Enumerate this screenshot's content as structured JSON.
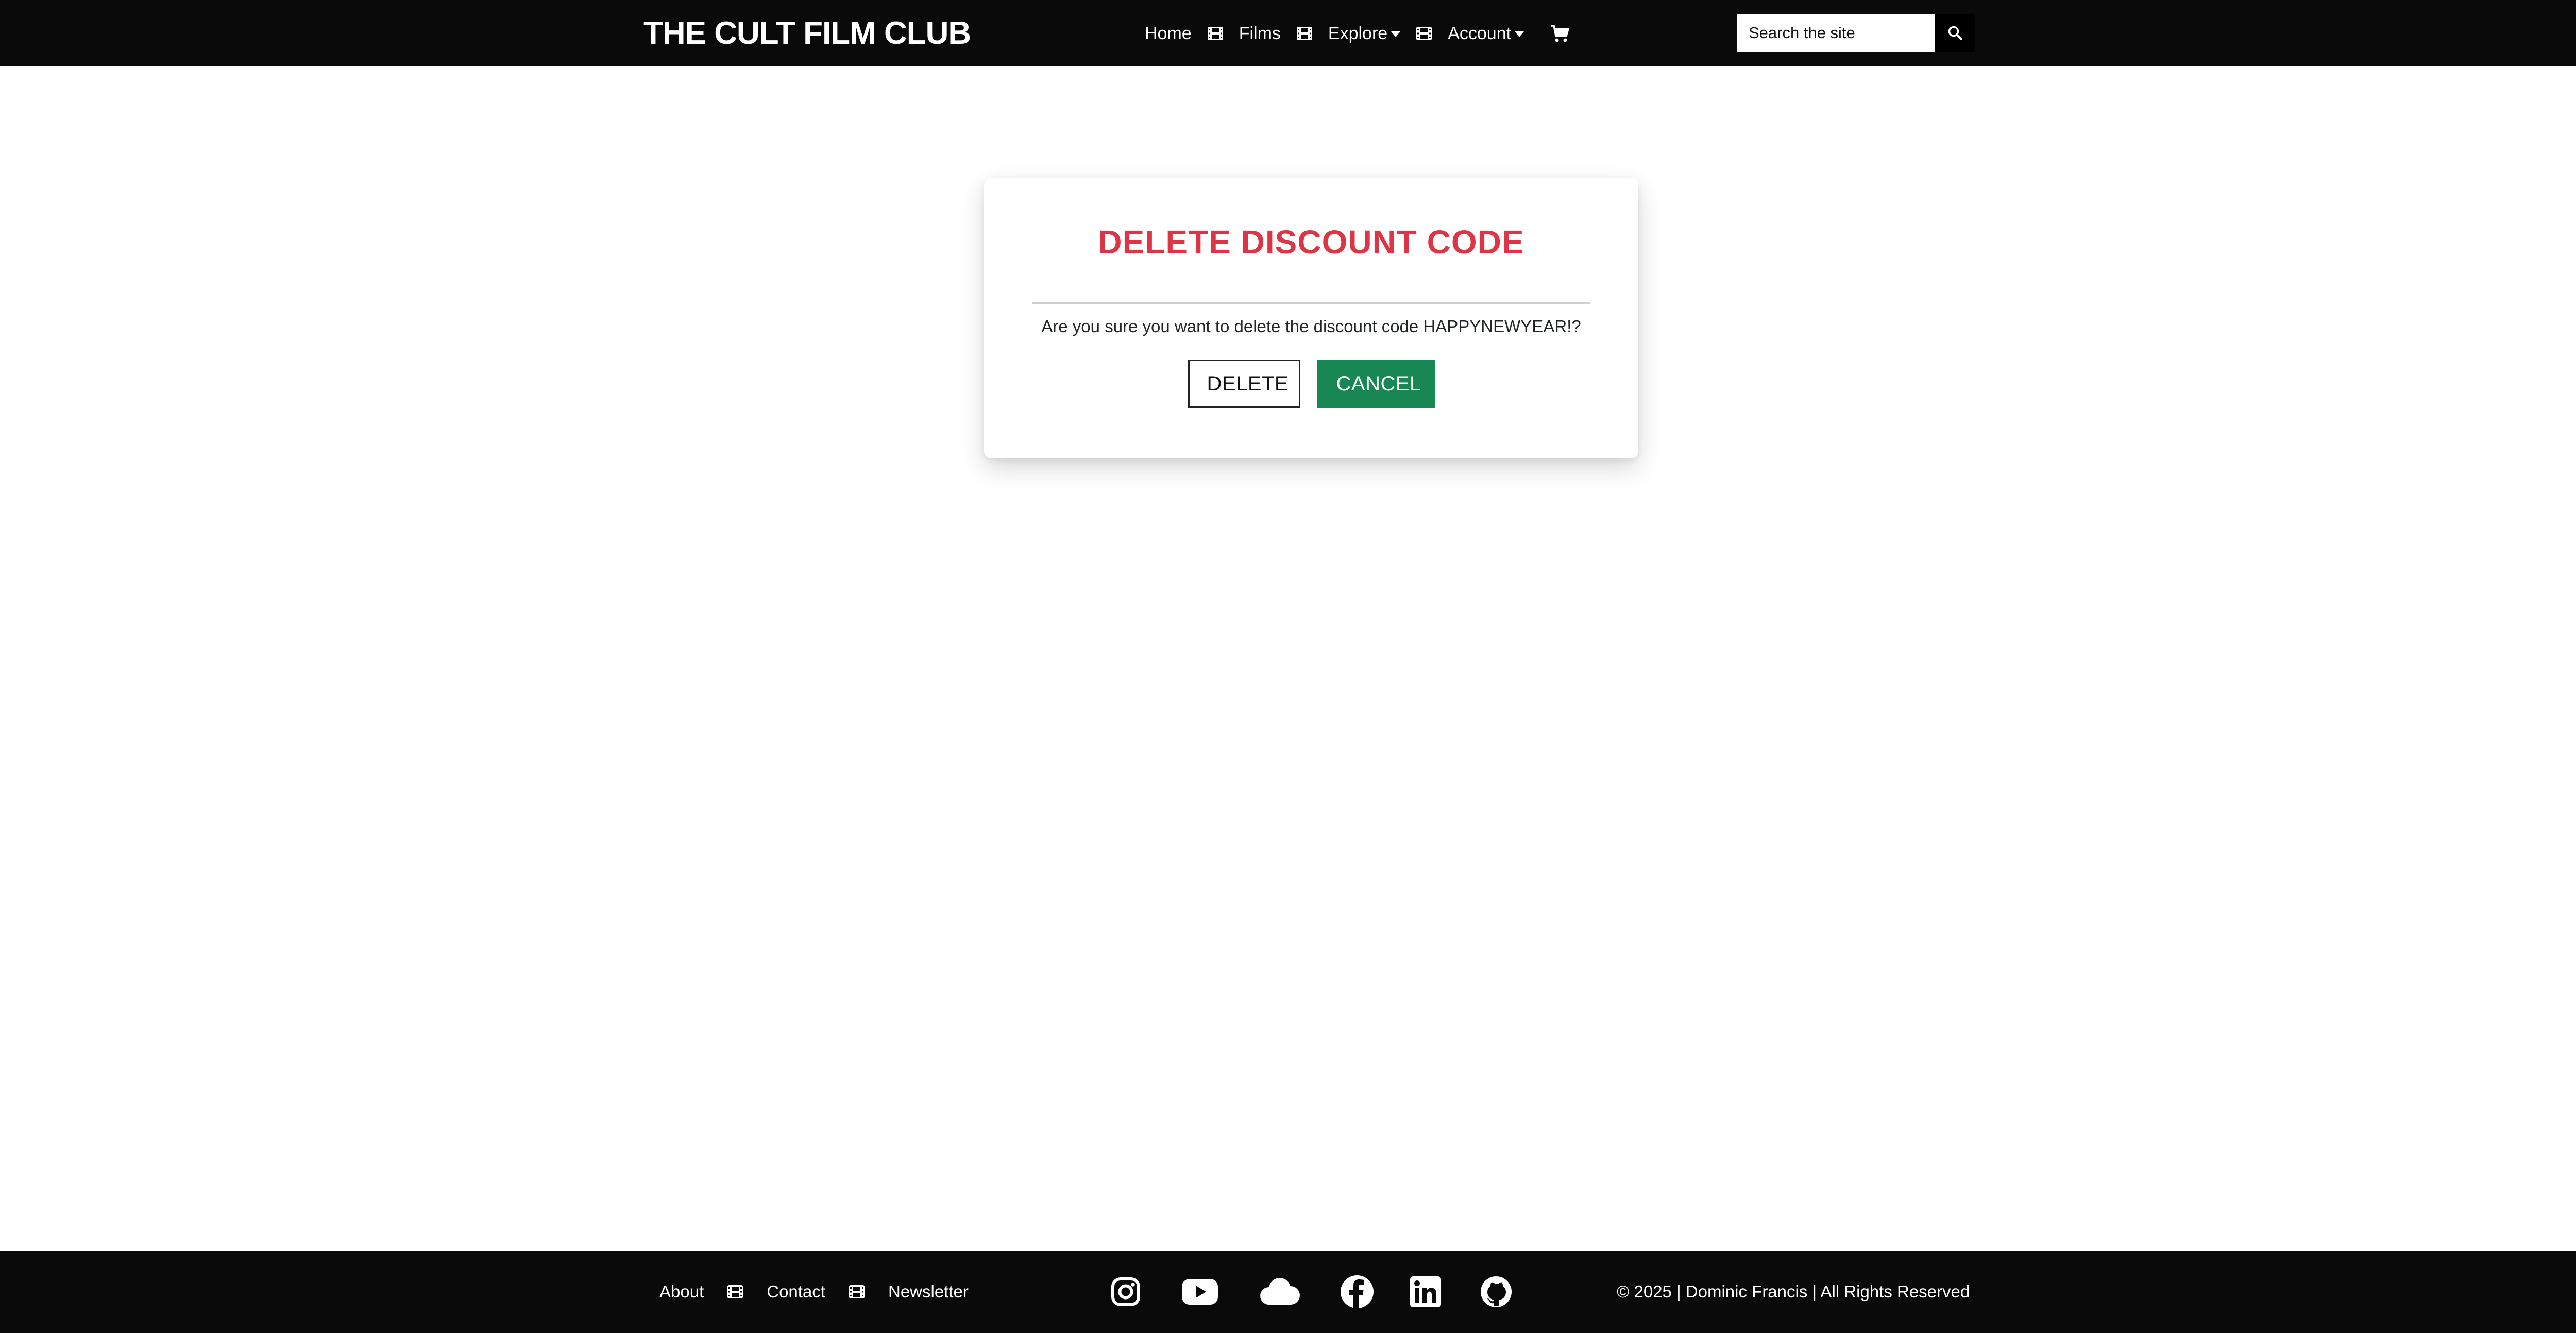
{
  "navbar": {
    "brand": "THE CULT FILM CLUB",
    "links": {
      "home": "Home",
      "films": "Films",
      "explore": "Explore",
      "account": "Account"
    },
    "search": {
      "placeholder": "Search the site"
    }
  },
  "dialog": {
    "title": "DELETE DISCOUNT CODE",
    "message": "Are you sure you want to delete the discount code HAPPYNEWYEAR!?",
    "delete_label": "DELETE",
    "cancel_label": "CANCEL"
  },
  "footer": {
    "links": {
      "about": "About",
      "contact": "Contact",
      "newsletter": "Newsletter"
    },
    "social": [
      "instagram-icon",
      "youtube-icon",
      "cloud-icon",
      "facebook-icon",
      "linkedin-icon",
      "github-icon"
    ],
    "copyright": "© 2025 | Dominic Francis | All Rights Reserved"
  },
  "colors": {
    "nav_bg": "#0a0a0a",
    "title_red": "#dc3545",
    "cancel_green": "#198754"
  }
}
